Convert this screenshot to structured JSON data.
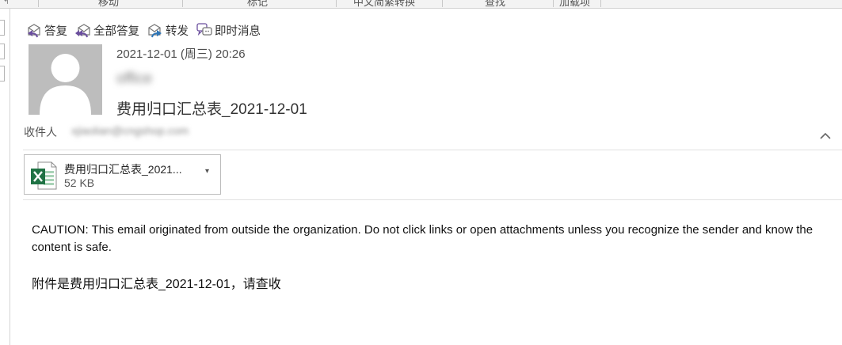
{
  "ribbon": {
    "groups": [
      "移动",
      "标记",
      "中文简繁转换",
      "查找",
      "加载项"
    ]
  },
  "actions": [
    {
      "label": "答复",
      "icon": "reply-icon"
    },
    {
      "label": "全部答复",
      "icon": "reply-all-icon"
    },
    {
      "label": "转发",
      "icon": "forward-icon"
    },
    {
      "label": "即时消息",
      "icon": "instant-message-icon"
    }
  ],
  "message": {
    "date": "2021-12-01 (周三) 20:26",
    "sender": "office",
    "subject": "费用归口汇总表_2021-12-01",
    "to_label": "收件人",
    "to_value": "xjiaolian@cngshop.com"
  },
  "attachment": {
    "name": "费用归口汇总表_2021...",
    "size": "52 KB",
    "icon": "excel-file-icon"
  },
  "body": {
    "caution": "CAUTION: This email originated from outside the organization. Do not click links or open attachments unless you recognize the sender and know the content is safe.",
    "note": "附件是费用归口汇总表_2021-12-01，请查收"
  },
  "colors": {
    "excel_green": "#1f7244",
    "avatar_gray": "#bdbdbd",
    "icon_purple": "#6b4f9e"
  }
}
